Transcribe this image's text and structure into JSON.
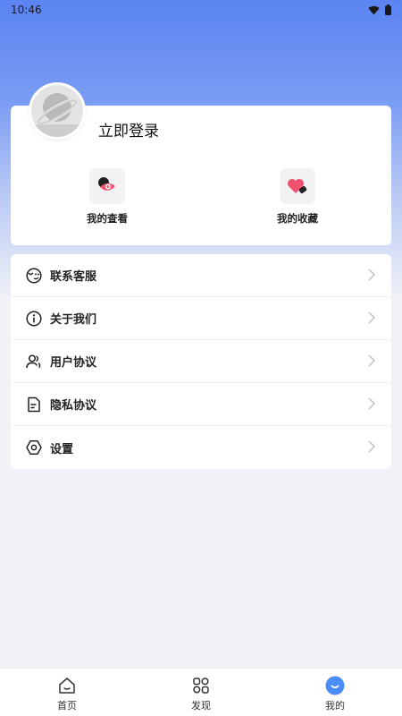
{
  "status_bar": {
    "time": "10:46"
  },
  "profile": {
    "login_label": "立即登录"
  },
  "quick_actions": [
    {
      "label": "我的查看",
      "icon": "view-history-icon"
    },
    {
      "label": "我的收藏",
      "icon": "favorites-heart-icon"
    }
  ],
  "menu": [
    {
      "label": "联系客服",
      "icon": "customer-service-icon"
    },
    {
      "label": "关于我们",
      "icon": "info-icon"
    },
    {
      "label": "用户协议",
      "icon": "users-icon"
    },
    {
      "label": "隐私协议",
      "icon": "document-icon"
    },
    {
      "label": "设置",
      "icon": "settings-hexagon-icon"
    }
  ],
  "tabs": [
    {
      "label": "首页",
      "icon": "home-icon",
      "active": false
    },
    {
      "label": "发现",
      "icon": "discover-grid-icon",
      "active": false
    },
    {
      "label": "我的",
      "icon": "mine-smile-icon",
      "active": true
    }
  ],
  "colors": {
    "accent": "#4a8df8",
    "pink": "#f0516e"
  }
}
